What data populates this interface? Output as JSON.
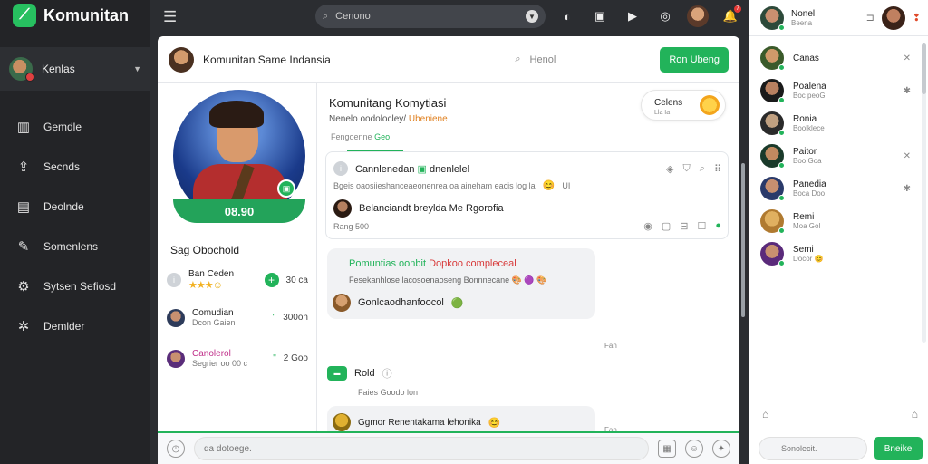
{
  "app": {
    "name": "Komunitan"
  },
  "sidebar": {
    "user_name": "Kenlas",
    "items": [
      {
        "label": "Gemdle",
        "icon": "chart-icon"
      },
      {
        "label": "Secnds",
        "icon": "upload-icon"
      },
      {
        "label": "Deolnde",
        "icon": "document-icon"
      },
      {
        "label": "Somenlens",
        "icon": "pen-icon"
      },
      {
        "label": "Sytsen Sefiosd",
        "icon": "gear-icon"
      },
      {
        "label": "Demlder",
        "icon": "settings-icon"
      }
    ]
  },
  "topbar": {
    "search_value": "Cenono",
    "notification_count": "7"
  },
  "main": {
    "header_title": "Komunitan Same Indansia",
    "search_label": "Henol",
    "header_button": "Ron Ubeng",
    "profile": {
      "score": "08.90",
      "label": "Sag Obochold",
      "rows": [
        {
          "name": "Ban Ceden",
          "value": "30 ca"
        },
        {
          "name": "Comudian",
          "sub": "Dcon Gaien",
          "mark": "\"",
          "value": "300on"
        },
        {
          "name": "Canolerol",
          "sub": "Segrier oo 00 c",
          "mark": "\"",
          "value": "2 Goo"
        }
      ]
    },
    "group": {
      "title": "Komunitang Komytiasi",
      "subtitle": "Nenelo oodolocley/",
      "subtitle_accent": "Ubeniene",
      "tab_text": "Fengoenne",
      "tab_accent": "Geo",
      "pill_title": "Celens",
      "pill_sub": "Lla  Ia"
    },
    "post": {
      "title": "Cannlenedan",
      "title_accent": "dnenlelel",
      "line2": "Bgeis oaosiieshanceaeonenrea oa aineham eacis log la",
      "line2_tail": "UI",
      "comment": "Belanciandt breylda Me Rgorofia",
      "comment_sub": "Rang  500"
    },
    "messages": [
      {
        "title_green": "Pomuntias oonbit",
        "title_red": "Dopkoo compleceal",
        "body": "Fesekanhlose lacosoenaoseng Bonnnecane",
        "reply": "Gonlcaodhanfoocol",
        "time": "Fan"
      },
      {
        "tag": "Rold",
        "sub": "Faies  Goodo lon"
      },
      {
        "text": "Ggmor Renentakama lehonika",
        "time": "Fan"
      }
    ],
    "composer_placeholder": "da dotoege."
  },
  "right": {
    "header": {
      "name": "Nonel",
      "sub": "Beena"
    },
    "contacts": [
      {
        "name": "Canas",
        "sub": ""
      },
      {
        "name": "Poalena",
        "sub": "Boc peoG"
      },
      {
        "name": "Ronia",
        "sub": "Boolklece"
      },
      {
        "name": "Paitor",
        "sub": "Boo Goa"
      },
      {
        "name": "Panedia",
        "sub": "Boca Doo"
      },
      {
        "name": "Remi",
        "sub": "Moa Gol"
      },
      {
        "name": "Semi",
        "sub": "Docor"
      }
    ],
    "search_placeholder": "Sonolecit.",
    "button": "Bneike"
  }
}
